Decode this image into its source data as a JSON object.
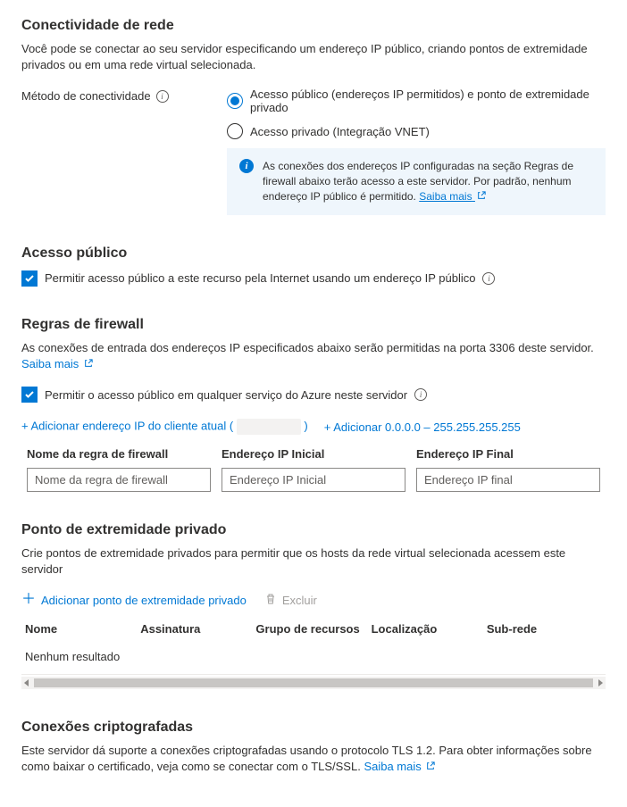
{
  "connectivity": {
    "heading": "Conectividade de rede",
    "description": "Você pode se conectar ao seu servidor especificando um endereço IP público, criando pontos de extremidade privados ou em uma rede virtual selecionada.",
    "method_label": "Método de conectividade",
    "option_public": "Acesso público (endereços IP permitidos) e ponto de extremidade privado",
    "option_private": "Acesso privado (Integração VNET)",
    "info_text": "As conexões dos endereços IP configuradas na seção Regras de firewall abaixo terão acesso a este servidor. Por padrão, nenhum endereço IP público é permitido. ",
    "info_link": "Saiba mais"
  },
  "public_access": {
    "heading": "Acesso público",
    "checkbox_label": "Permitir acesso público a este recurso pela Internet usando um endereço IP público"
  },
  "firewall": {
    "heading": "Regras de firewall",
    "description_prefix": "As conexões de entrada dos endereços IP especificados abaixo serão permitidas na porta 3306 deste servidor. ",
    "learn_more": "Saiba mais",
    "checkbox_label": "Permitir o acesso público em qualquer serviço do Azure neste servidor",
    "add_client_prefix": "+ Adicionar endereço IP do cliente atual (",
    "add_client_suffix": ")",
    "add_range": "+ Adicionar 0.0.0.0 – 255.255.255.255",
    "col_name": "Nome da regra de firewall",
    "col_start": "Endereço IP Inicial",
    "col_end": "Endereço IP Final",
    "ph_name": "Nome da regra de firewall",
    "ph_start": "Endereço IP Inicial",
    "ph_end": "Endereço IP final"
  },
  "private_endpoint": {
    "heading": "Ponto de extremidade privado",
    "description": "Crie pontos de extremidade privados para permitir que os hosts da rede virtual selecionada acessem este servidor",
    "add_label": "Adicionar ponto de extremidade privado",
    "delete_label": "Excluir",
    "col_name": "Nome",
    "col_subscription": "Assinatura",
    "col_rg": "Grupo de recursos",
    "col_location": "Localização",
    "col_subnet": "Sub-rede",
    "empty": "Nenhum resultado"
  },
  "encrypted": {
    "heading": "Conexões criptografadas",
    "description_prefix": "Este servidor dá suporte a conexões criptografadas usando o protocolo TLS 1.2. Para obter informações sobre como baixar o certificado, veja como se conectar com o TLS/SSL. ",
    "learn_more": "Saiba mais"
  }
}
